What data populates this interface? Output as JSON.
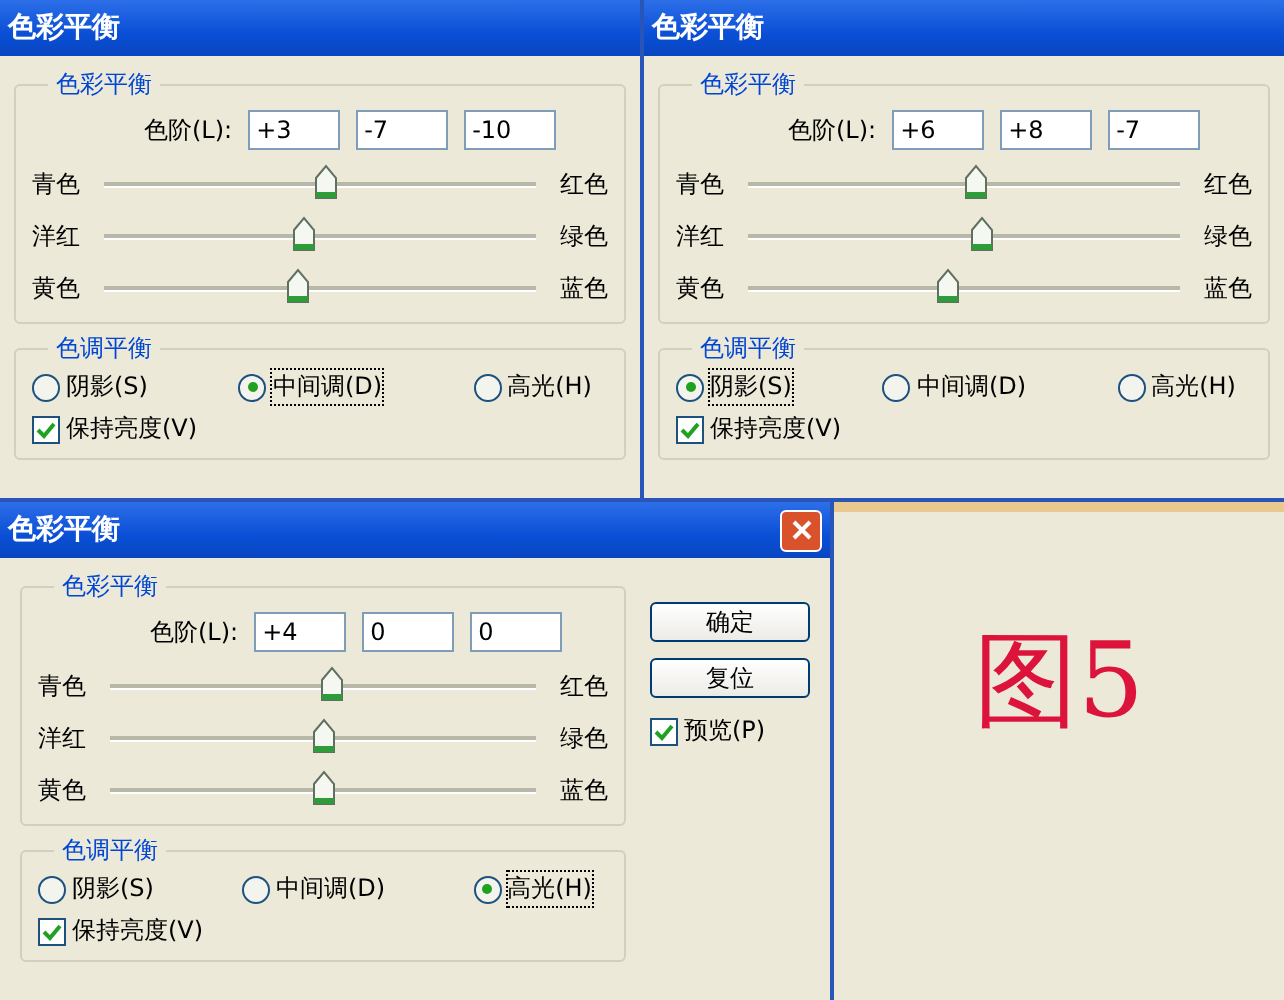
{
  "dialogs": [
    {
      "title": "色彩平衡",
      "has_close": false,
      "color_group": {
        "legend": "色彩平衡",
        "levels_label": "色阶(L):",
        "values": [
          "+3",
          "-7",
          "-10"
        ],
        "sliders": [
          {
            "left": "青色",
            "right": "红色",
            "level": 0.515
          },
          {
            "left": "洋红",
            "right": "绿色",
            "level": 0.465
          },
          {
            "left": "黄色",
            "right": "蓝色",
            "level": 0.45
          }
        ]
      },
      "tone_group": {
        "legend": "色调平衡",
        "options": [
          {
            "label": "阴影(S)",
            "selected": false
          },
          {
            "label": "中间调(D)",
            "selected": true
          },
          {
            "label": "高光(H)",
            "selected": false
          }
        ],
        "preserve": {
          "label": "保持亮度(V)",
          "checked": true
        }
      }
    },
    {
      "title": "色彩平衡",
      "has_close": false,
      "color_group": {
        "legend": "色彩平衡",
        "levels_label": "色阶(L):",
        "values": [
          "+6",
          "+8",
          "-7"
        ],
        "sliders": [
          {
            "left": "青色",
            "right": "红色",
            "level": 0.53
          },
          {
            "left": "洋红",
            "right": "绿色",
            "level": 0.54
          },
          {
            "left": "黄色",
            "right": "蓝色",
            "level": 0.465
          }
        ]
      },
      "tone_group": {
        "legend": "色调平衡",
        "options": [
          {
            "label": "阴影(S)",
            "selected": true
          },
          {
            "label": "中间调(D)",
            "selected": false
          },
          {
            "label": "高光(H)",
            "selected": false
          }
        ],
        "preserve": {
          "label": "保持亮度(V)",
          "checked": true
        }
      }
    },
    {
      "title": "色彩平衡",
      "has_close": true,
      "color_group": {
        "legend": "色彩平衡",
        "levels_label": "色阶(L):",
        "values": [
          "+4",
          "0",
          "0"
        ],
        "sliders": [
          {
            "left": "青色",
            "right": "红色",
            "level": 0.52
          },
          {
            "left": "洋红",
            "right": "绿色",
            "level": 0.5
          },
          {
            "left": "黄色",
            "right": "蓝色",
            "level": 0.5
          }
        ]
      },
      "tone_group": {
        "legend": "色调平衡",
        "options": [
          {
            "label": "阴影(S)",
            "selected": false
          },
          {
            "label": "中间调(D)",
            "selected": false
          },
          {
            "label": "高光(H)",
            "selected": true
          }
        ],
        "preserve": {
          "label": "保持亮度(V)",
          "checked": true
        }
      },
      "buttons": [
        "确定",
        "复位"
      ],
      "preview": {
        "label": "预览(P)",
        "checked": true
      }
    }
  ],
  "caption": "图5"
}
